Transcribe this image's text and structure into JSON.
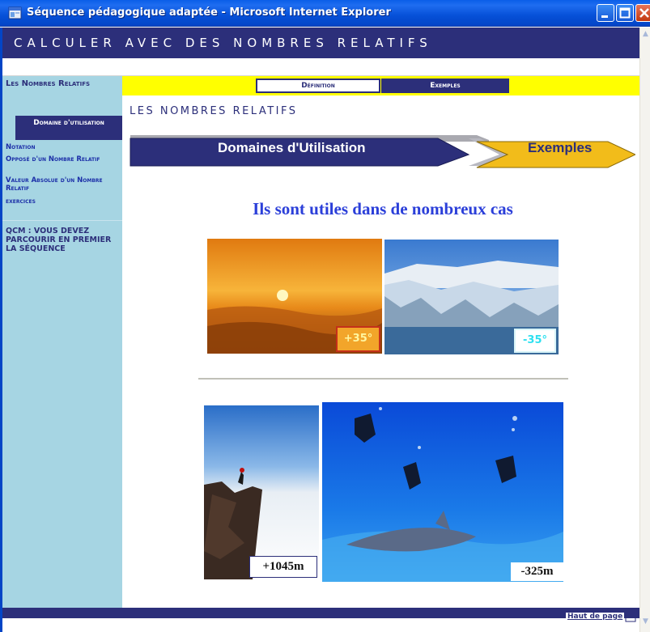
{
  "window": {
    "title": "Séquence pédagogique adaptée - Microsoft Internet Explorer"
  },
  "header": {
    "title": "CALCULER AVEC DES NOMBRES RELATIFS"
  },
  "sidebar": {
    "section_title": "Les Nombres Relatifs",
    "active_item": "Domaine d'utilisation",
    "items": [
      {
        "label": "Notation"
      },
      {
        "label": "Opposé d'un Nombre Relatif"
      },
      {
        "label": "Valeur Absolue d'un Nombre Relatif"
      },
      {
        "label": "exercices"
      }
    ],
    "qcm_note": "QCM : VOUS DEVEZ PARCOURIR EN PREMIER LA SÉQUENCE"
  },
  "tabs": {
    "definition": "Définition",
    "exemples": "Exemples"
  },
  "content": {
    "heading": "LES NOMBRES RELATIFS",
    "banner_left": "Domaines d'Utilisation",
    "banner_right": "Exemples",
    "headline": "Ils sont utiles dans de nombreux cas",
    "labels": {
      "hot": "+35°",
      "cold": "-35°",
      "altitude": "+1045m",
      "depth": "-325m"
    }
  },
  "footer": {
    "back_to_top": "Haut de page"
  },
  "colors": {
    "navy": "#2c2f7a",
    "sidebar": "#a6d5e3",
    "tab_bar": "#ffff00",
    "headline": "#2b3fd9",
    "banner_arrow": "#f2bc1a"
  },
  "icons": {
    "app": "ie-window-icon",
    "minimize": "minimize-icon",
    "maximize": "maximize-icon",
    "close": "close-icon",
    "back_to_top": "arrow-up-icon"
  }
}
